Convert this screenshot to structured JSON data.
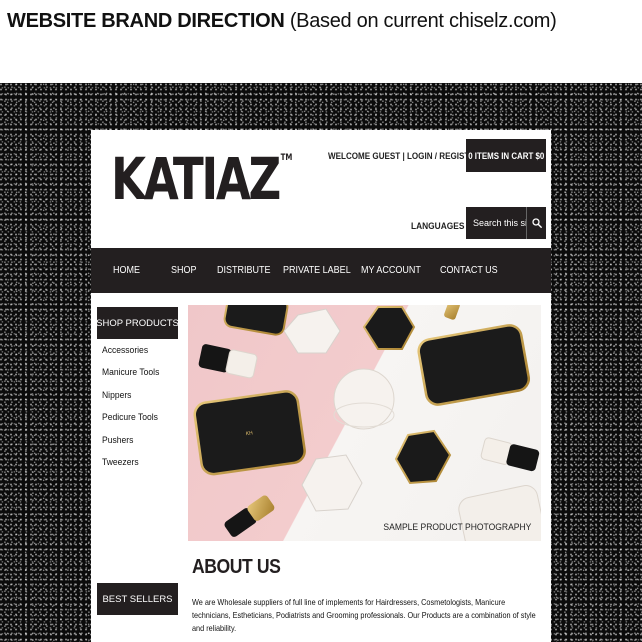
{
  "doc_heading": {
    "bold": "WEBSITE BRAND DIRECTION",
    "normal": "(Based on current chiselz.com)"
  },
  "header": {
    "logo": "KATIAZ",
    "logo_tm": "TM",
    "account_links": "WELCOME GUEST | LOGIN / REGISTER",
    "cart": "0 ITEMS IN CART  $0",
    "languages": "LANGUAGES",
    "search_placeholder": "Search this site"
  },
  "nav": {
    "items": [
      {
        "label": "HOME"
      },
      {
        "label": "SHOP"
      },
      {
        "label": "DISTRIBUTE"
      },
      {
        "label": "PRIVATE LABEL"
      },
      {
        "label": "MY ACCOUNT"
      },
      {
        "label": "CONTACT US"
      }
    ]
  },
  "sidebar": {
    "heading": "SHOP PRODUCTS",
    "categories": [
      {
        "label": "Accessories"
      },
      {
        "label": "Manicure Tools"
      },
      {
        "label": "Nippers"
      },
      {
        "label": "Pedicure Tools"
      },
      {
        "label": "Pushers"
      },
      {
        "label": "Tweezers"
      }
    ],
    "best_sellers": "BEST SELLERS"
  },
  "hero": {
    "caption": "SAMPLE PRODUCT PHOTOGRAPHY"
  },
  "about": {
    "title": "ABOUT US",
    "body": "We are Wholesale suppliers of full line of implements for Hairdressers, Cosmetologists, Manicure technicians, Estheticians, Podiatrists and Grooming professionals. Our Products are a combination of style and reliability."
  },
  "colors": {
    "dark": "#231f20",
    "hero_pink": "#f0c7c9",
    "hero_white": "#f5f3f1",
    "gold": "#c9a24a"
  },
  "icons": {
    "search": "magnifier-icon"
  }
}
